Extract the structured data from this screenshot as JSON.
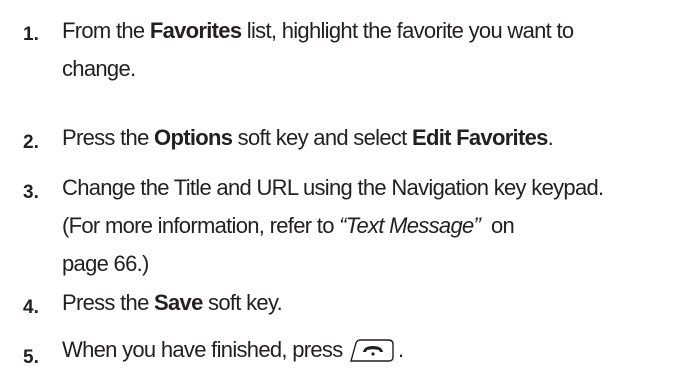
{
  "steps": [
    {
      "number": "1.",
      "t1": "From the ",
      "b1": "Favorites",
      "t2": " list, highlight the favorite you want to",
      "t3": "change."
    },
    {
      "number": "2.",
      "t1": "Press the ",
      "b1": "Options",
      "t2": " soft key and select ",
      "b2": "Edit Favorites",
      "t3": "."
    },
    {
      "number": "3.",
      "line1": "Change the Title and URL using the Navigation key keypad.",
      "t1": "(For more information, refer to ",
      "link": "“Text Message”",
      "t2": "  on",
      "line3": "page 66.)"
    },
    {
      "number": "4.",
      "t1": "Press the ",
      "b1": "Save",
      "t2": " soft key."
    },
    {
      "number": "5.",
      "t1": "When you have finished, press ",
      "t2": ".",
      "key_icon": "end-key-icon"
    }
  ]
}
